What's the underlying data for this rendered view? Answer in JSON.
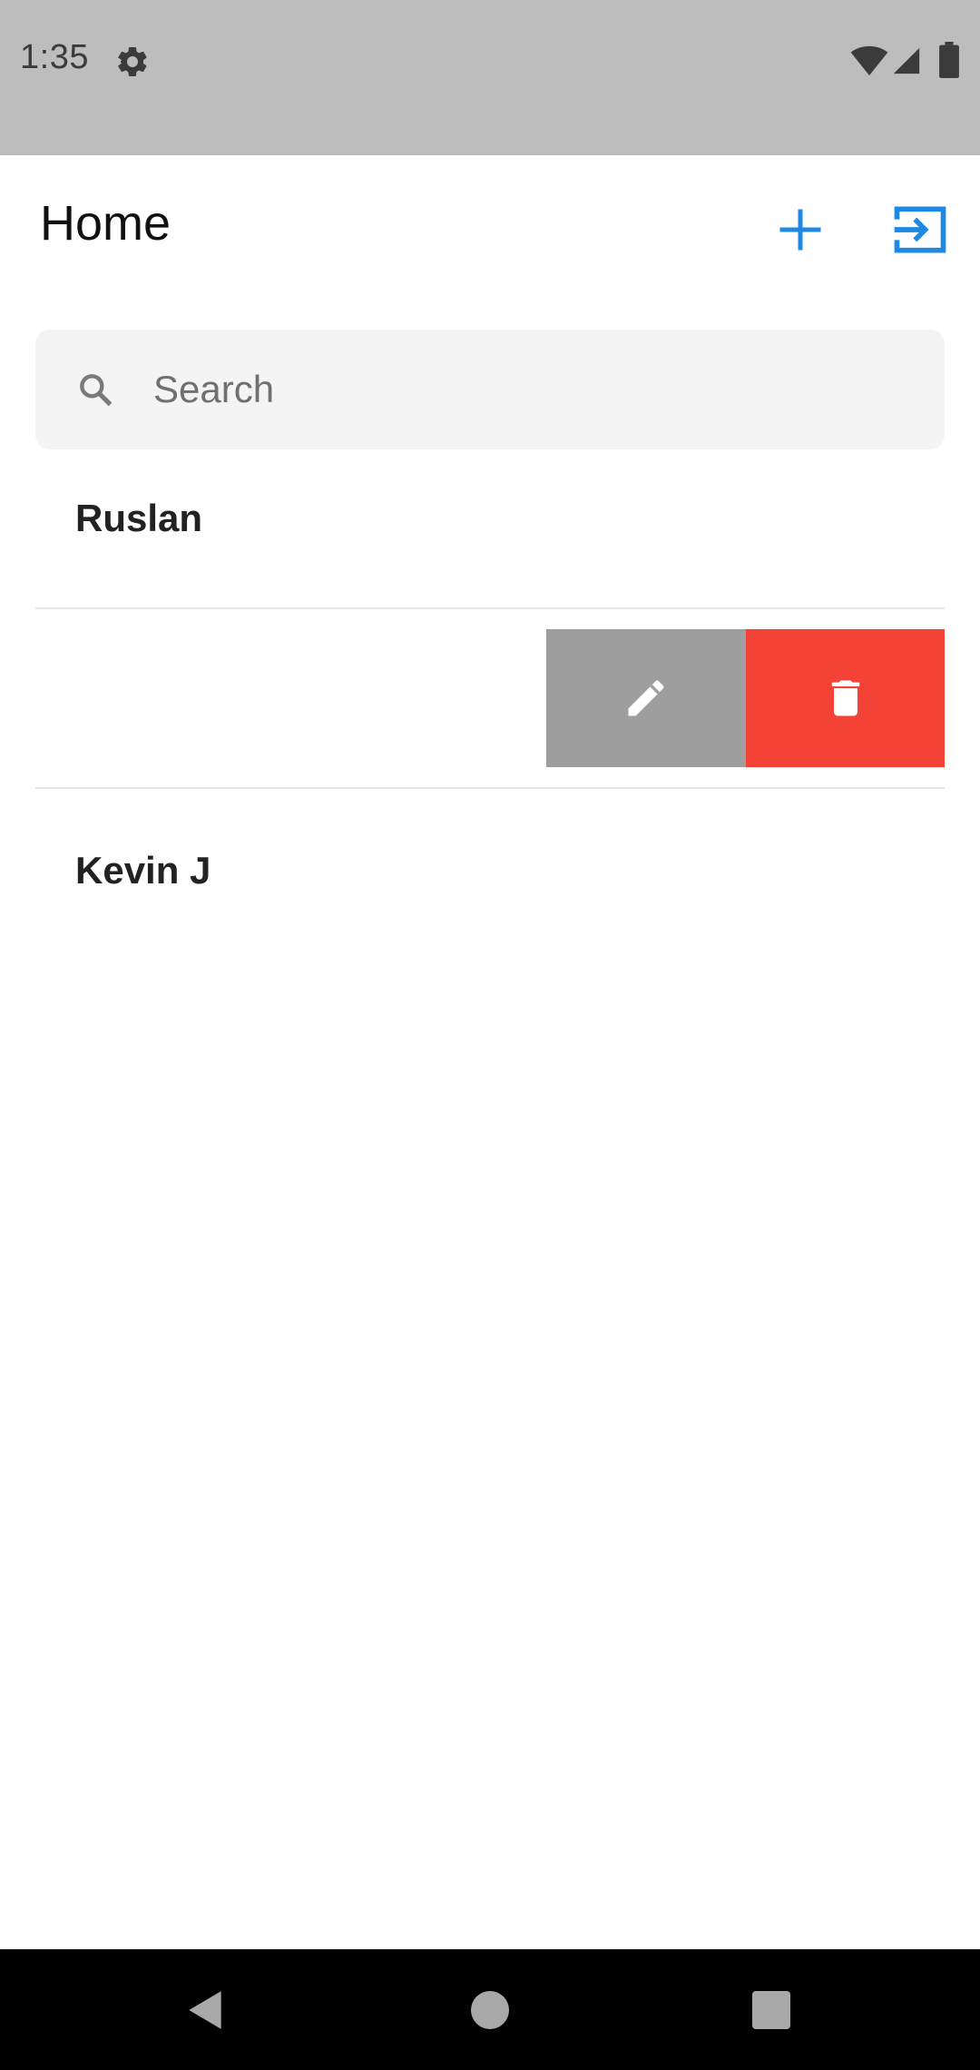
{
  "status_bar": {
    "time": "1:35",
    "icons": [
      "gear-icon",
      "wifi-icon",
      "signal-icon",
      "battery-icon"
    ]
  },
  "header": {
    "title": "Home",
    "add_icon": "plus-icon",
    "logout_icon": "exit-icon",
    "accent_color": "#1e88e5"
  },
  "search": {
    "placeholder": "Search",
    "value": ""
  },
  "contacts": [
    {
      "name": "Ruslan"
    },
    {
      "name": "",
      "swiped": true
    },
    {
      "name": "Kevin J"
    }
  ],
  "swipe_actions": {
    "edit": {
      "icon": "pencil-icon",
      "color": "#9e9e9e"
    },
    "delete": {
      "icon": "trash-icon",
      "color": "#f44336"
    }
  },
  "nav_bar": {
    "buttons": [
      "back-icon",
      "home-icon",
      "recents-icon"
    ]
  }
}
